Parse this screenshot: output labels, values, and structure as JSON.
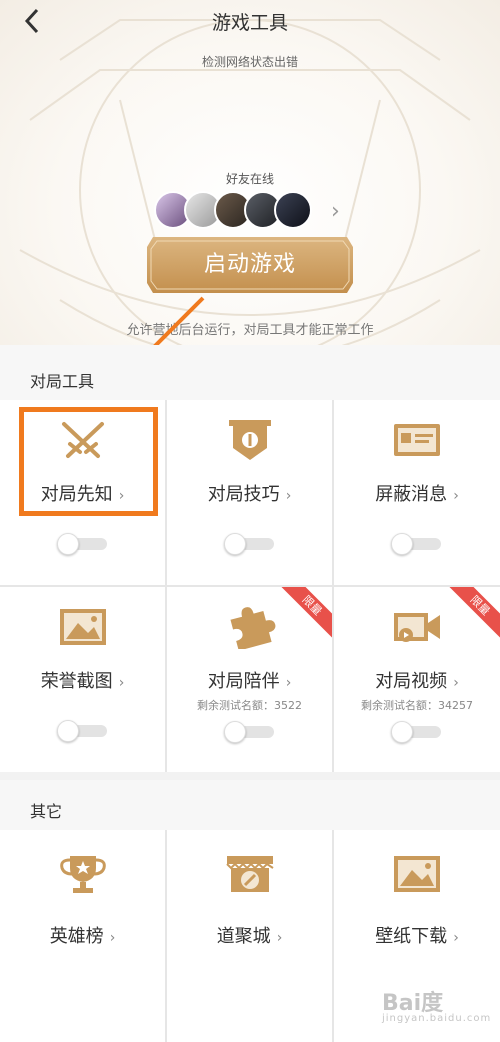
{
  "header": {
    "title": "游戏工具",
    "subtitle": "检测网络状态出错"
  },
  "friends": {
    "label": "好友在线",
    "avatars": [
      "avatar-1",
      "avatar-2",
      "avatar-3",
      "avatar-4",
      "avatar-5"
    ]
  },
  "start_button": {
    "label": "启动游戏"
  },
  "hint": "允许营地后台运行，对局工具才能正常工作",
  "section_tools": {
    "title": "对局工具",
    "items": [
      {
        "label": "对局先知",
        "icon": "crossed-swords-icon",
        "toggle": "off"
      },
      {
        "label": "对局技巧",
        "icon": "banner-shield-icon",
        "toggle": "off"
      },
      {
        "label": "屏蔽消息",
        "icon": "message-card-icon",
        "toggle": "off"
      },
      {
        "label": "荣誉截图",
        "icon": "picture-icon",
        "toggle": "off"
      },
      {
        "label": "对局陪伴",
        "icon": "puzzle-icon",
        "toggle": "off",
        "quota": "剩余测试名额：3522",
        "badge": "限量"
      },
      {
        "label": "对局视频",
        "icon": "video-camera-icon",
        "toggle": "off",
        "quota": "剩余测试名额：34257",
        "badge": "限量"
      }
    ]
  },
  "section_other": {
    "title": "其它",
    "items": [
      {
        "label": "英雄榜",
        "icon": "trophy-icon"
      },
      {
        "label": "道聚城",
        "icon": "shop-icon"
      },
      {
        "label": "壁纸下载",
        "icon": "wallpaper-icon"
      }
    ]
  },
  "chevron": "›",
  "watermark": {
    "text": "Bai度",
    "sub": "jingyan.baidu.com"
  },
  "colors": {
    "gold": "#c99a5b",
    "highlight": "#f07a1e",
    "ribbon": "#e8514a"
  }
}
